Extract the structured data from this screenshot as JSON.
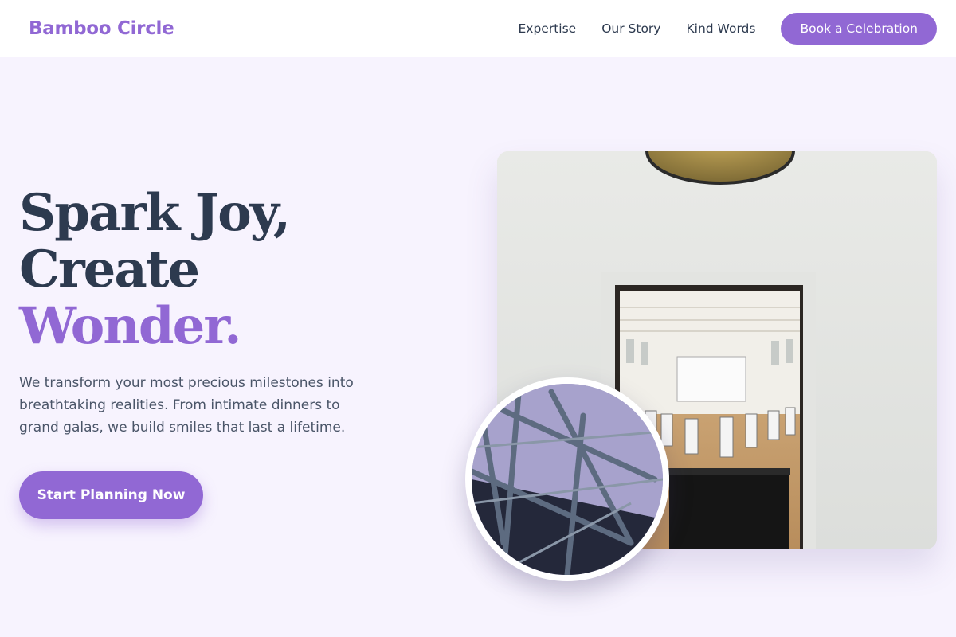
{
  "header": {
    "logo": "Bamboo Circle",
    "nav": [
      {
        "label": "Expertise"
      },
      {
        "label": "Our Story"
      },
      {
        "label": "Kind Words"
      }
    ],
    "cta_label": "Book a Celebration"
  },
  "hero": {
    "headline_line1": "Spark Joy,",
    "headline_line2": "Create",
    "headline_accent": "Wonder.",
    "subtext": "We transform your most precious milestones into breathtaking realities. From intimate dinners to grand galas, we build smiles that last a lifetime.",
    "cta_label": "Start Planning Now"
  },
  "colors": {
    "accent": "#9168d4",
    "heading": "#2d3a4f",
    "background": "#f7f3fe"
  }
}
